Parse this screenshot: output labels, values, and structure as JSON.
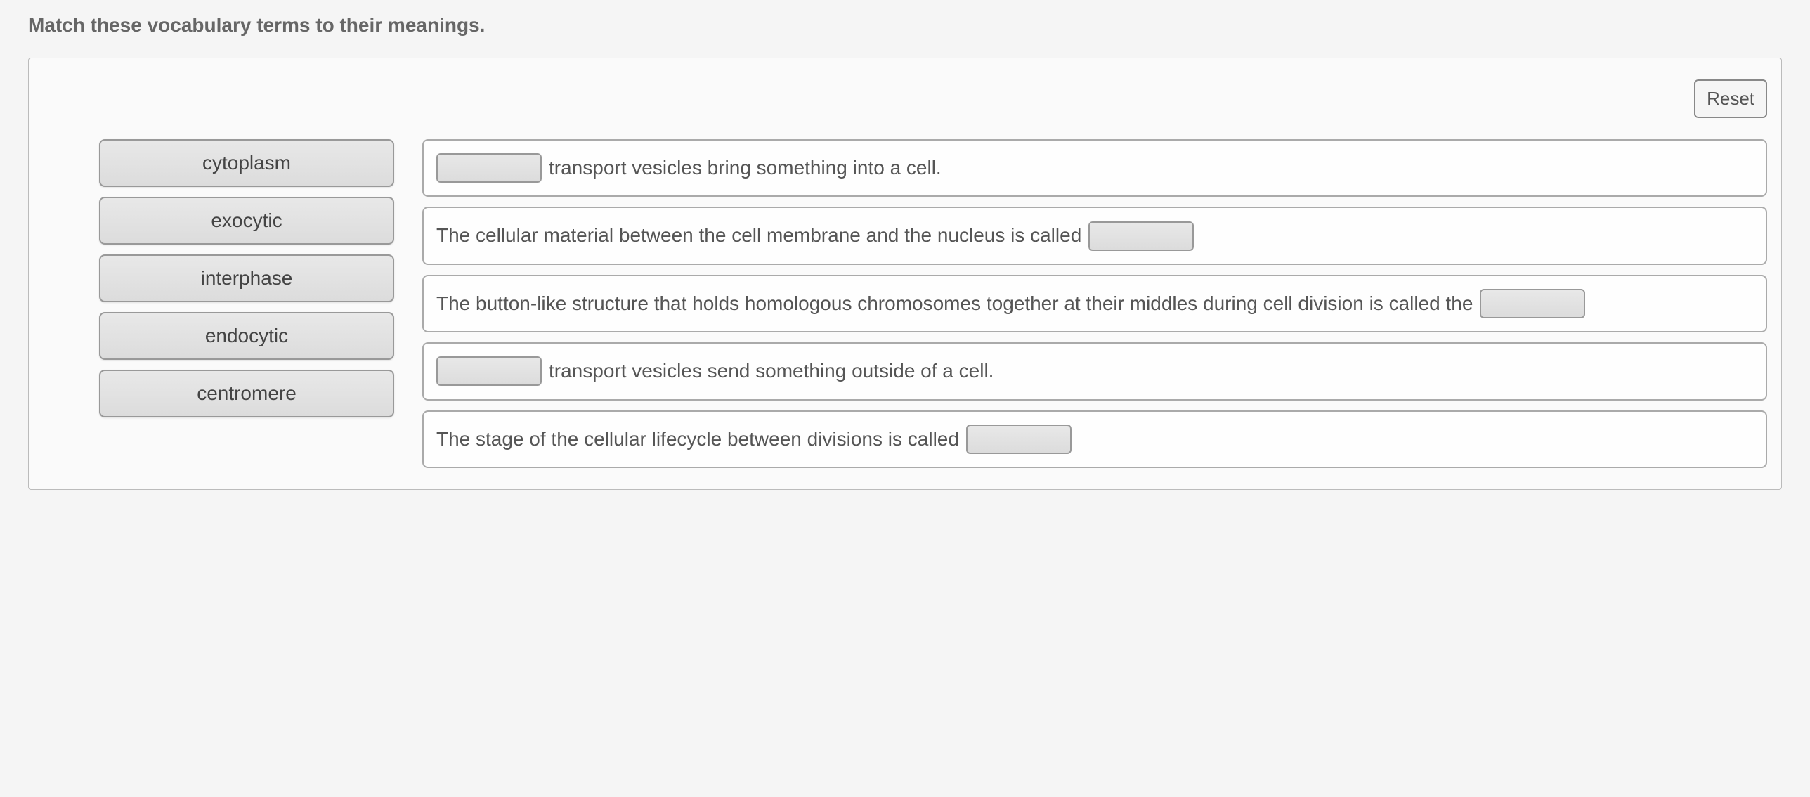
{
  "instruction": "Match these vocabulary terms to their meanings.",
  "reset_label": "Reset",
  "terms": {
    "t0": "cytoplasm",
    "t1": "exocytic",
    "t2": "interphase",
    "t3": "endocytic",
    "t4": "centromere"
  },
  "definitions": {
    "d0_after": "transport vesicles bring something into a cell.",
    "d1_before": "The cellular material between the cell membrane and the nucleus is called",
    "d2_before": "The button-like structure that holds homologous chromosomes together at their middles during cell division is called the",
    "d3_after": "transport vesicles send something outside of a cell.",
    "d4_before": "The stage of the cellular lifecycle between divisions is called"
  }
}
